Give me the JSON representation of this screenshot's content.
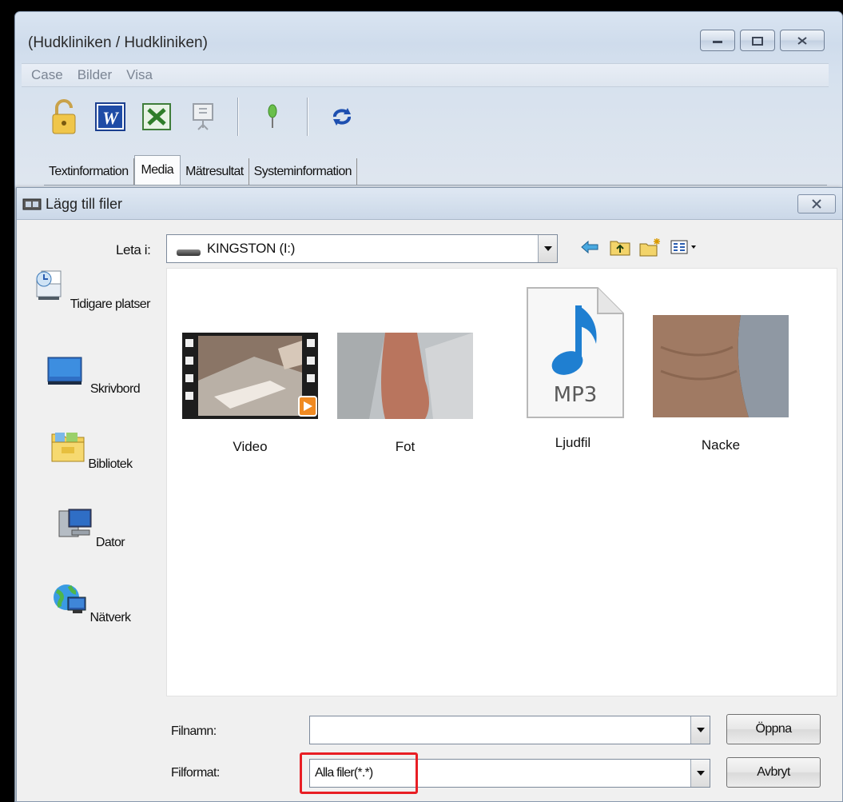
{
  "main_window": {
    "title": "(Hudkliniken / Hudkliniken)",
    "controls": {
      "minimize": "▭",
      "maximize": "⧉",
      "close": "✕"
    },
    "menu": [
      "Case",
      "Bilder",
      "Visa"
    ],
    "toolbar_icons": [
      "lock-icon",
      "word-icon",
      "excel-icon",
      "presentation-icon",
      "pin-icon",
      "refresh-icon"
    ],
    "tabs": [
      "Textinformation",
      "Media",
      "Mätresultat",
      "Systeminformation"
    ],
    "active_tab": "Media"
  },
  "dialog": {
    "title": "Lägg till filer",
    "close": "✕",
    "look_in_label": "Leta i:",
    "look_in_value": "KINGSTON (I:)",
    "nav_icons": [
      "back-icon",
      "up-folder-icon",
      "new-folder-icon",
      "view-menu-icon"
    ],
    "places": [
      "Tidigare platser",
      "Skrivbord",
      "Bibliotek",
      "Dator",
      "Nätverk"
    ],
    "files": [
      {
        "name": "Video",
        "type": "video"
      },
      {
        "name": "Fot",
        "type": "image"
      },
      {
        "name": "Ljudfil",
        "type": "audio",
        "badge": "MP3"
      },
      {
        "name": "Nacke",
        "type": "image"
      }
    ],
    "filename_label": "Filnamn:",
    "filename_value": "",
    "filetype_label": "Filformat:",
    "filetype_value": "Alla filer(*.*)",
    "open_button": "Öppna",
    "cancel_button": "Avbryt"
  },
  "colors": {
    "highlight": "#e81e24",
    "accent_blue": "#1f7fd1"
  }
}
